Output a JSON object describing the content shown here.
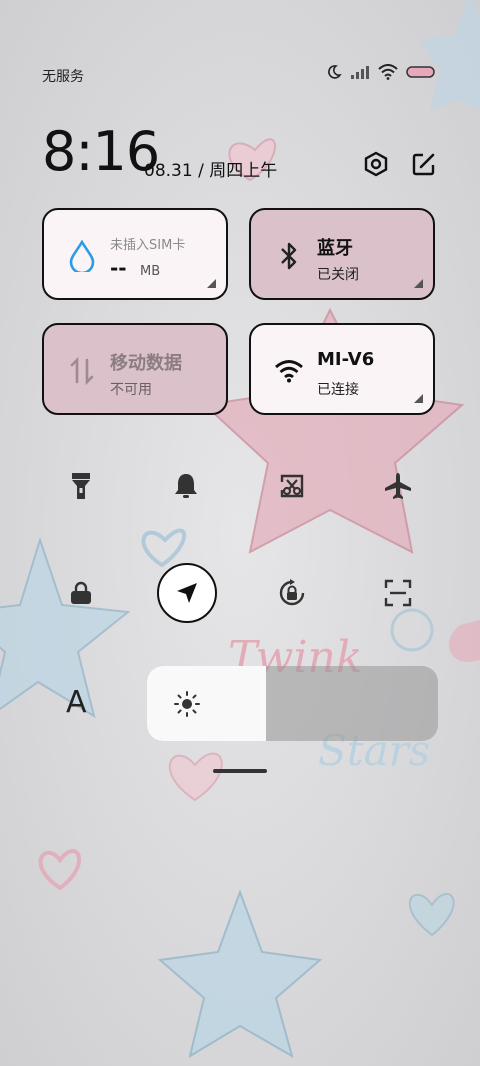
{
  "status_bar": {
    "carrier_text": "无服务",
    "icons": [
      "moon-icon",
      "signal-icon",
      "wifi-icon",
      "battery-icon"
    ],
    "battery_color": "#e8a8bc"
  },
  "header": {
    "time": "8:16",
    "date": "08.31 / 周四上午",
    "settings_icon": "gear-icon",
    "edit_icon": "edit-icon"
  },
  "tiles": {
    "data_usage": {
      "label": "未插入SIM卡",
      "value": "--",
      "unit": "MB",
      "icon": "water-drop-icon"
    },
    "bluetooth": {
      "title": "蓝牙",
      "status": "已关闭",
      "icon": "bluetooth-icon"
    },
    "mobile_data": {
      "title": "移动数据",
      "status": "不可用",
      "icon": "data-arrows-icon"
    },
    "wifi": {
      "title": "MI-V6",
      "status": "已连接",
      "icon": "wifi-icon"
    }
  },
  "toggles": {
    "row1": [
      "flashlight-icon",
      "bell-icon",
      "screenshot-icon",
      "airplane-icon"
    ],
    "row2": [
      "lock-icon",
      "location-icon",
      "rotation-lock-icon",
      "scan-icon"
    ]
  },
  "brightness": {
    "font_size_label": "A",
    "level": 0.41
  },
  "wallpaper": {
    "text1": "Twink",
    "text2": "Stars",
    "accent_pink": "#e3aab8",
    "accent_blue": "#b7d2e0"
  }
}
